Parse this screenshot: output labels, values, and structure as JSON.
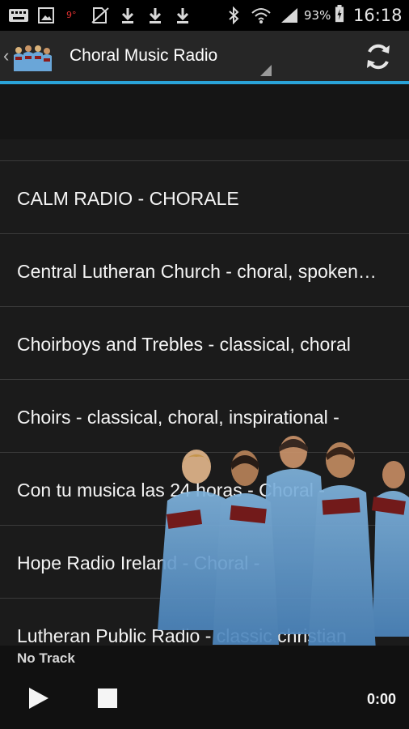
{
  "status_bar": {
    "notification_icons": [
      "keyboard-icon",
      "image-icon",
      "temperature-icon",
      "no-sim-icon",
      "download-icon",
      "download-icon",
      "download-icon"
    ],
    "temperature": "9°",
    "battery_percent": "93%",
    "time": "16:18"
  },
  "action_bar": {
    "title": "Choral Music Radio",
    "refresh_icon": "refresh-icon",
    "accent_color": "#2aa3d8"
  },
  "stations": [
    "CALM RADIO - CHORALE",
    "Central Lutheran Church - choral, spoken word",
    "Choirboys and Trebles - classical, choral",
    "Choirs - classical, choral, inspirational -",
    "Con tu musica las 24 horas - Choral -",
    "Hope Radio Ireland - Choral -",
    "Lutheran Public Radio - classic christian"
  ],
  "player": {
    "track": "No Track",
    "time": "0:00"
  }
}
